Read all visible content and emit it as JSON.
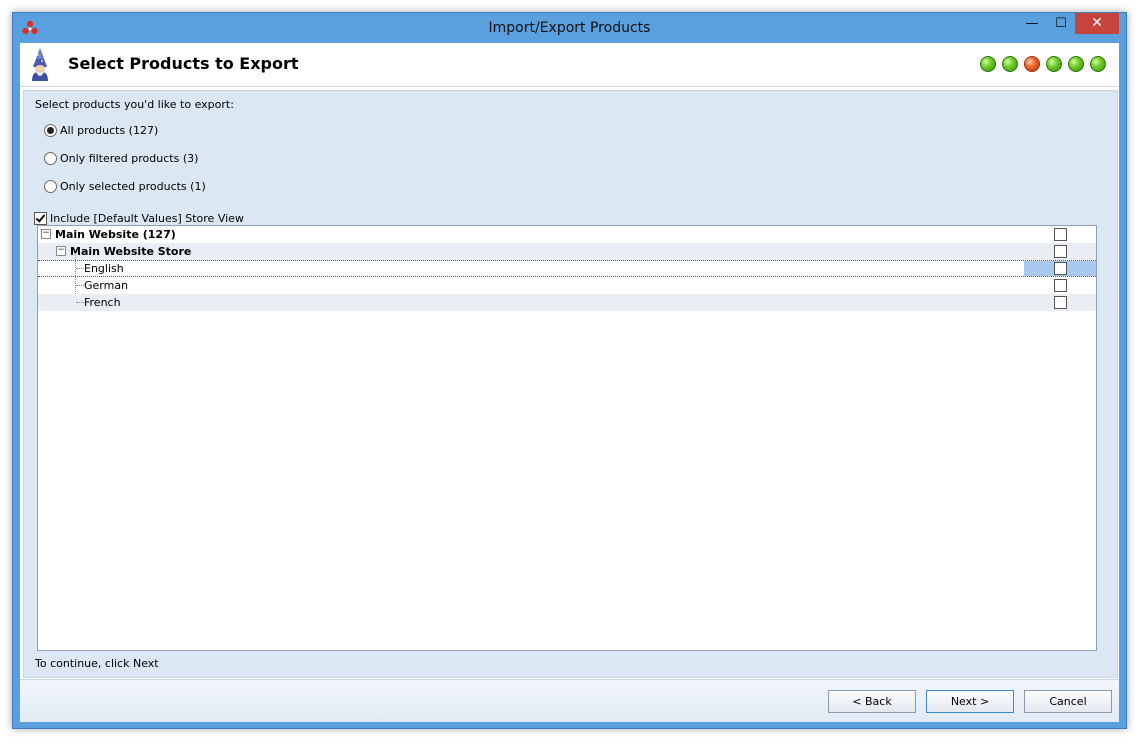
{
  "window": {
    "title": "Import/Export Products",
    "minimize_label": "—",
    "maximize_label": "☐",
    "close_label": "✕"
  },
  "header": {
    "title": "Select Products to Export",
    "steps": [
      "done",
      "done",
      "current",
      "done",
      "done",
      "done"
    ]
  },
  "prompt": "Select products you'd like to export:",
  "options": {
    "all": "All products (127)",
    "filtered": "Only filtered products (3)",
    "selected": "Only selected products (1)",
    "selected_option": "all"
  },
  "include_default": {
    "label": "Include [Default Values] Store View",
    "checked": true
  },
  "tree": {
    "website": "Main Website (127)",
    "store": "Main Website Store",
    "views": [
      "English",
      "German",
      "French"
    ]
  },
  "footer_hint": "To continue, click Next",
  "buttons": {
    "back": "< Back",
    "next": "Next >",
    "cancel": "Cancel"
  },
  "colors": {
    "title_bar": "#5aa0df",
    "panel": "#dbe7f3",
    "step_done": "#6fcb2a",
    "step_current": "#f0662e"
  }
}
